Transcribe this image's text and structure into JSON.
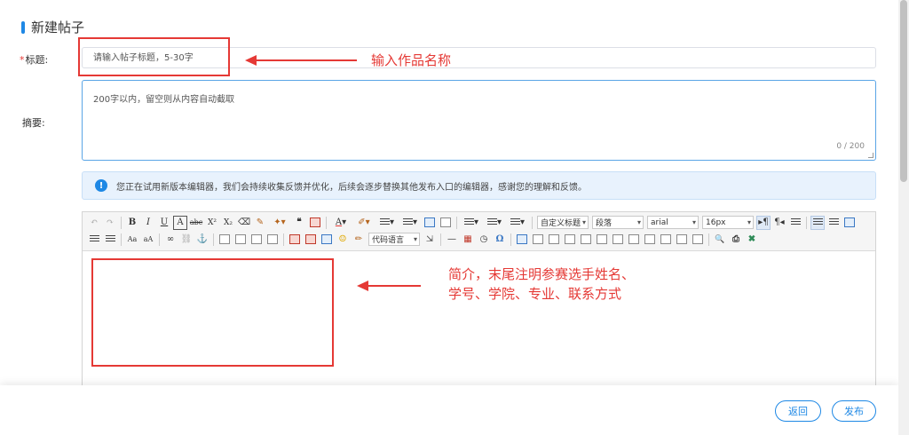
{
  "header": {
    "title": "新建帖子"
  },
  "form": {
    "title_required_mark": "*",
    "title_label": "标题:",
    "title_placeholder": "请输入帖子标题，5-30字",
    "summary_label": "摘要:",
    "summary_placeholder": "200字以内，留空则从内容自动截取",
    "summary_counter": "0 / 200"
  },
  "notice": {
    "icon": "info-icon",
    "text": "您正在试用新版本编辑器，我们会持续收集反馈并优化，后续会逐步替换其他发布入口的编辑器，感谢您的理解和反馈。"
  },
  "editor": {
    "selects": {
      "custom_title": "自定义标题",
      "paragraph": "段落",
      "font_family": "arial",
      "font_size": "16px",
      "code_language": "代码语言"
    },
    "toolbar_glyphs": {
      "undo": "↶",
      "redo": "↷",
      "bold": "B",
      "italic": "I",
      "underline": "U",
      "border": "A",
      "strike": "abc",
      "superscript": "X²",
      "subscript": "X₂",
      "eraser": "⌫",
      "quote": "❝",
      "omega": "Ω",
      "anchor": "⚓",
      "link": "∞",
      "search": "🔍",
      "horizontal_rule": "—",
      "fontcolor": "A"
    }
  },
  "annotations": {
    "title_hint": "输入作品名称",
    "content_hint_line1": "简介，末尾注明参赛选手姓名、",
    "content_hint_line2": "学号、学院、专业、联系方式"
  },
  "footer": {
    "back_label": "返回",
    "publish_label": "发布"
  },
  "colors": {
    "accent": "#1e88e5",
    "annotation_red": "#e53935"
  }
}
